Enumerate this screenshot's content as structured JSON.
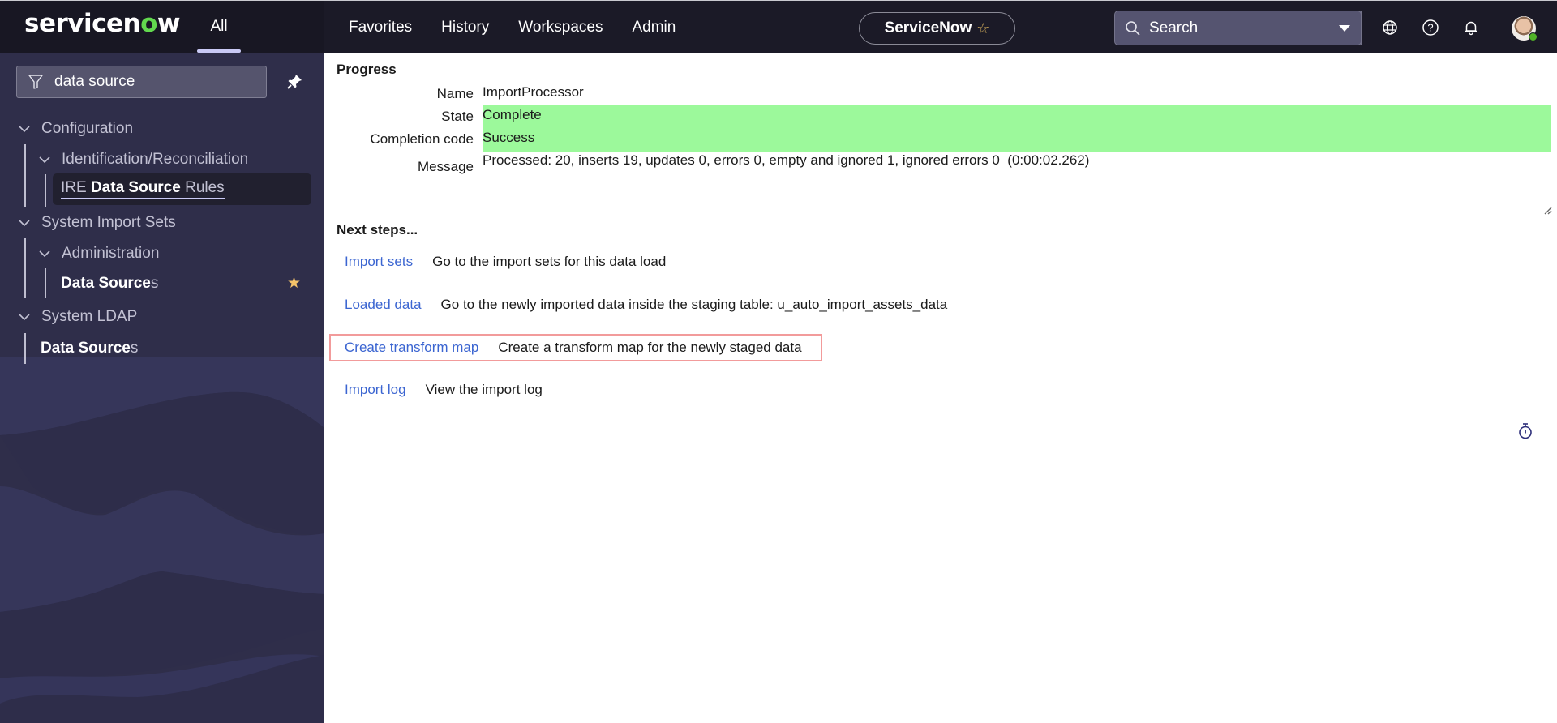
{
  "header": {
    "logo_text_pre": "servicen",
    "logo_text_o": "o",
    "logo_text_post": "w",
    "all_tab": "All",
    "nav": [
      "Favorites",
      "History",
      "Workspaces",
      "Admin"
    ],
    "instance_name": "ServiceNow",
    "instance_star": "☆",
    "search_placeholder": "Search",
    "icons": [
      "globe-icon",
      "help-icon",
      "bell-icon"
    ],
    "avatar_status": "online"
  },
  "sidebar": {
    "filter_value": "data source",
    "tree": [
      {
        "label": "Configuration",
        "level": 0,
        "expanded": true
      },
      {
        "label": "Identification/Reconciliation",
        "level": 1,
        "expanded": true
      },
      {
        "label_prefix": "IRE ",
        "label_match": "Data Source",
        "label_suffix": " Rules",
        "level": 2,
        "active": true
      },
      {
        "label": "System Import Sets",
        "level": 0,
        "expanded": true
      },
      {
        "label": "Administration",
        "level": 1,
        "expanded": true
      },
      {
        "label_match": "Data Source",
        "label_suffix": "s",
        "level": 2,
        "favorite": true
      },
      {
        "label": "System LDAP",
        "level": 0,
        "expanded": true
      },
      {
        "label_match": "Data Source",
        "label_suffix": "s",
        "level": 1
      }
    ],
    "favorite_star": "★"
  },
  "main": {
    "progress": {
      "title": "Progress",
      "fields": [
        {
          "label": "Name",
          "value": "ImportProcessor"
        },
        {
          "label": "State",
          "value": "Complete"
        },
        {
          "label": "Completion code",
          "value": "Success"
        },
        {
          "label": "Message",
          "value": "Processed: 20, inserts 19, updates 0, errors 0, empty and ignored 1, ignored errors 0  (0:00:02.262)"
        }
      ],
      "status_color": "#9cf99b"
    },
    "next_steps": {
      "title": "Next steps...",
      "items": [
        {
          "link": "Import sets",
          "description": "Go to the import sets for this data load"
        },
        {
          "link": "Loaded data",
          "description": "Go to the newly imported data inside the staging table: u_auto_import_assets_data"
        },
        {
          "link": "Create transform map",
          "description": "Create a transform map for the newly staged data",
          "highlighted": true
        },
        {
          "link": "Import log",
          "description": "View the import log"
        }
      ]
    }
  },
  "colors": {
    "accent_link": "#3b65d1",
    "highlight_border": "#f29b9b",
    "success_bg": "#9cf99b",
    "logo_green": "#62d84e"
  }
}
